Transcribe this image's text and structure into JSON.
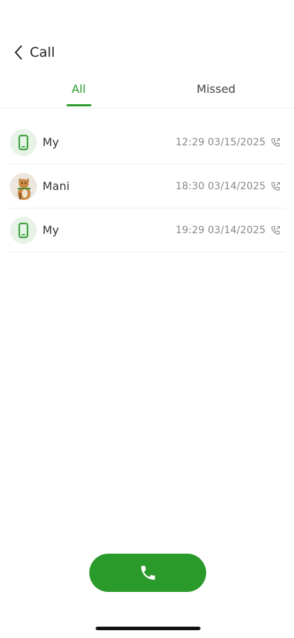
{
  "header": {
    "title": "Call"
  },
  "tabs": [
    {
      "label": "All",
      "active": true
    },
    {
      "label": "Missed",
      "active": false
    }
  ],
  "calls": [
    {
      "name": "My",
      "time": "12:29",
      "date": "03/15/2025",
      "avatar_icon": "phone-device-icon",
      "direction_icon": "outgoing-call-icon"
    },
    {
      "name": "Mani",
      "time": "18:30",
      "date": "03/14/2025",
      "avatar_icon": "cat-photo",
      "direction_icon": "outgoing-call-icon"
    },
    {
      "name": "My",
      "time": "19:29",
      "date": "03/14/2025",
      "avatar_icon": "phone-device-icon",
      "direction_icon": "outgoing-call-icon"
    }
  ],
  "call_time_display": [
    "12:29  03/15/2025",
    "18:30  03/14/2025",
    "19:29  03/14/2025"
  ],
  "actions": {
    "call_button_icon": "phone-icon"
  },
  "colors": {
    "accent": "#2a9a2a",
    "avatar_bg": "#e8f3e8",
    "text_muted": "#888888"
  }
}
